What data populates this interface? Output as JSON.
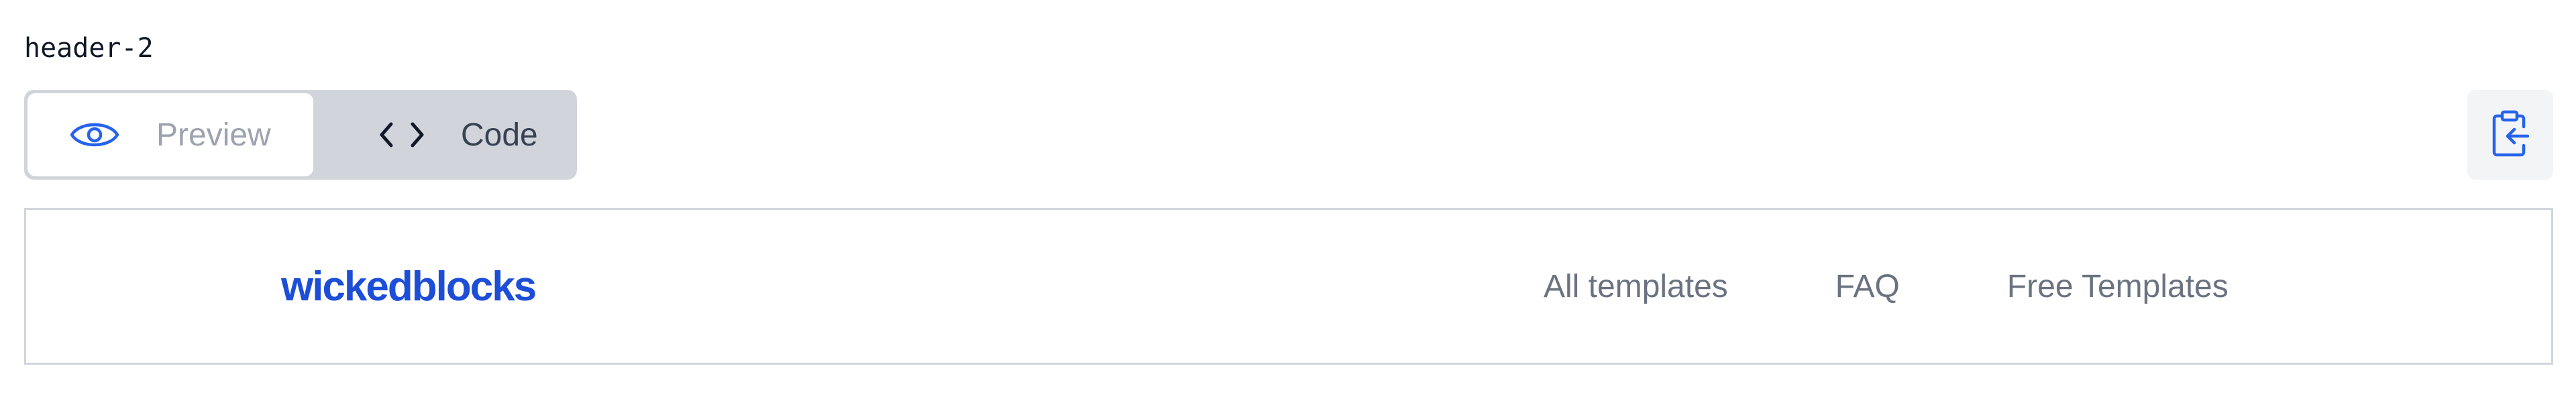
{
  "block": {
    "name": "header-2"
  },
  "view_toggle": {
    "preview_label": "Preview",
    "code_label": "Code",
    "active": "Preview"
  },
  "preview": {
    "logo_text": "wickedblocks",
    "nav_links": [
      "All templates",
      "FAQ",
      "Free Templates"
    ]
  },
  "icons": {
    "preview": "eye-icon",
    "code": "code-brackets-icon",
    "copy": "clipboard-copy-icon"
  },
  "colors": {
    "accent": "#1d4ed8",
    "icon_blue": "#2563eb",
    "muted_text": "#6b7280",
    "toggle_bg": "#d1d5db"
  }
}
